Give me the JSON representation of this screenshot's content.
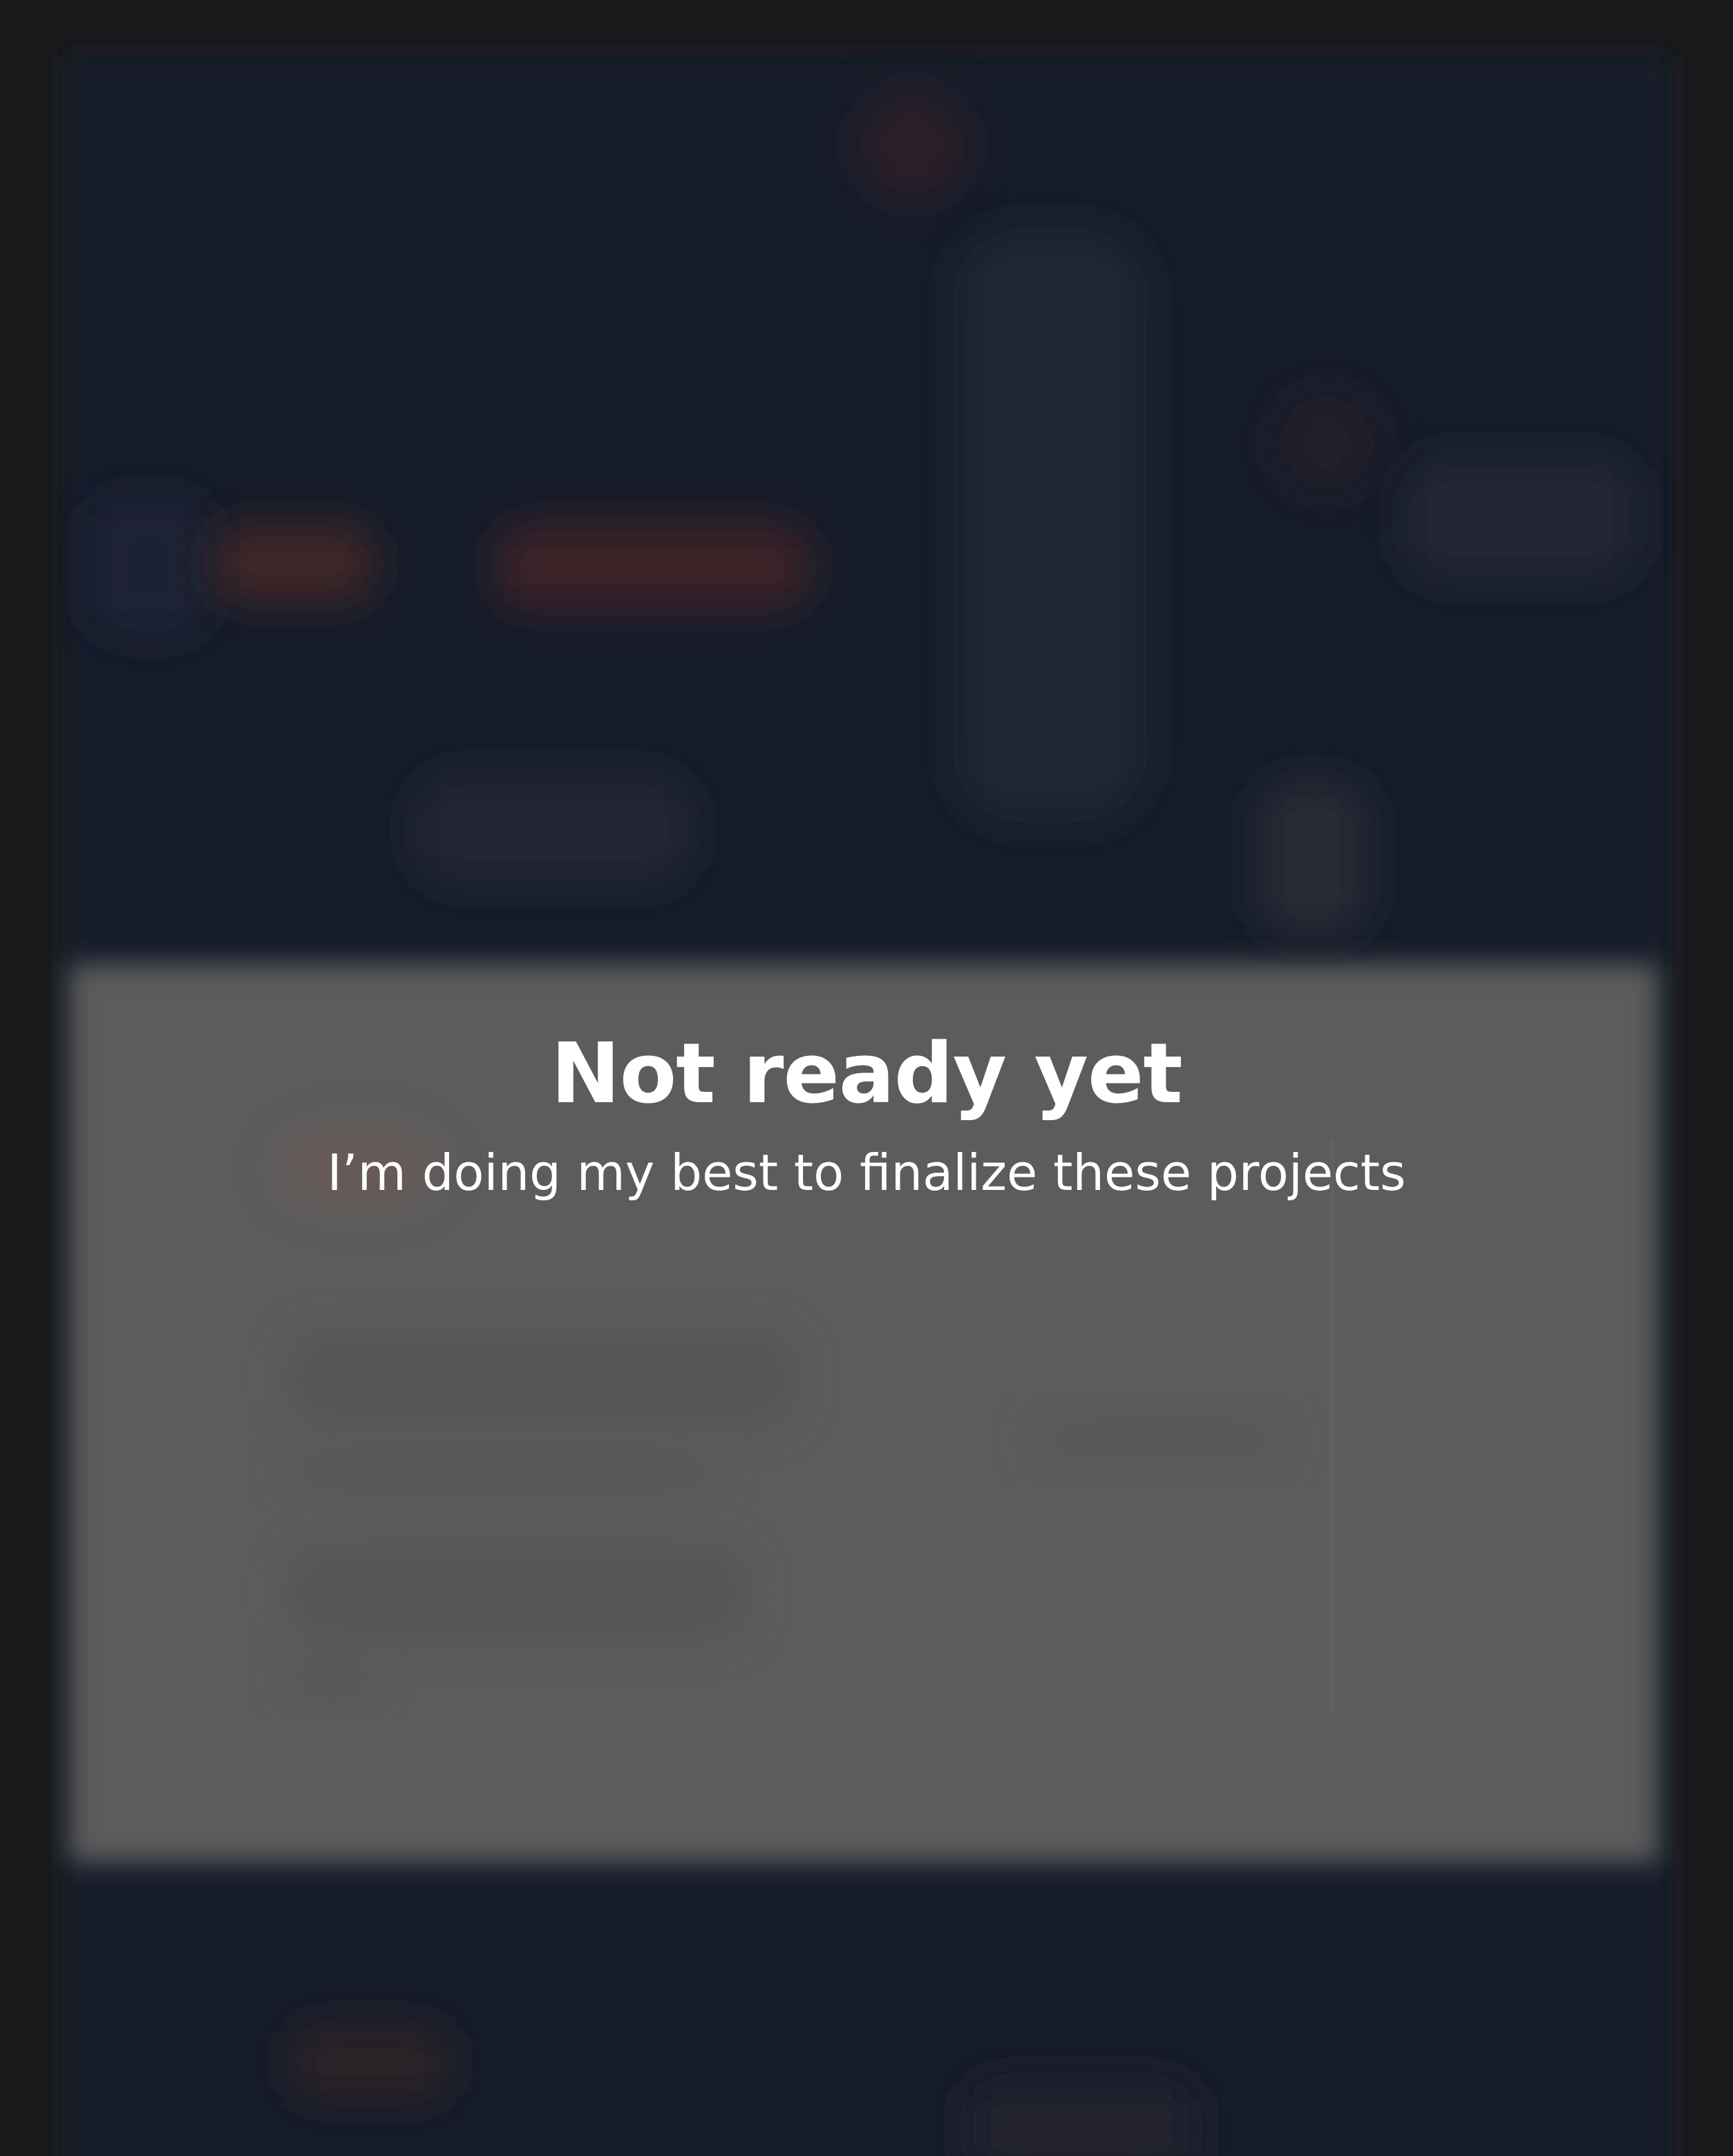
{
  "notice": {
    "title": "Not ready yet",
    "message": "I’m doing my best to finalize these projects"
  },
  "colors": {
    "frame": "#1a1a1b",
    "page_dark": "#171c2a",
    "overlay_gray": "#5c5c5c",
    "accent_red": "#e0463c",
    "text": "#ffffff"
  }
}
